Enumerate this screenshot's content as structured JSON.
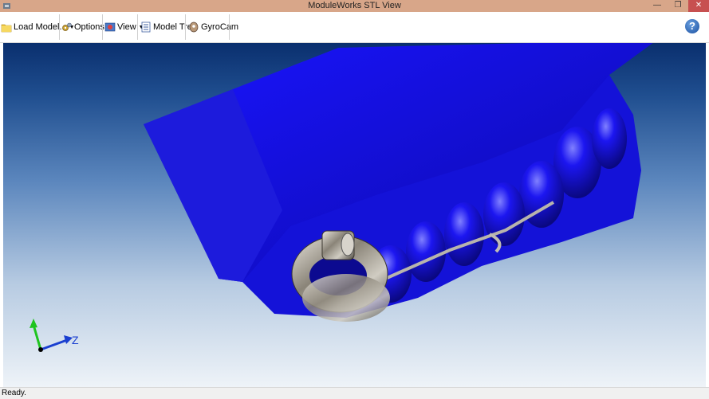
{
  "window": {
    "title": "ModuleWorks STL View",
    "controls": {
      "minimize": "—",
      "restore": "❐",
      "close": "✕"
    }
  },
  "toolbar": {
    "items": [
      {
        "label": "Load Model...",
        "icon": "folder-icon",
        "has_dropdown": true
      },
      {
        "label": "Options",
        "icon": "gears-icon",
        "has_dropdown": true
      },
      {
        "label": "View",
        "icon": "view-icon",
        "has_dropdown": true
      },
      {
        "label": "Model Tree",
        "icon": "tree-icon",
        "has_dropdown": false
      },
      {
        "label": "GyroCam",
        "icon": "gyrocam-icon",
        "has_dropdown": false
      }
    ],
    "help_label": "?"
  },
  "viewport": {
    "axis_label": "Z",
    "colors": {
      "model": "#1a10e0",
      "background_top": "#0a2f6e",
      "background_bottom": "#eef3f8",
      "axis_y": "#1fc41f",
      "axis_z": "#1a3fd0"
    }
  },
  "status": {
    "text": "Ready."
  }
}
